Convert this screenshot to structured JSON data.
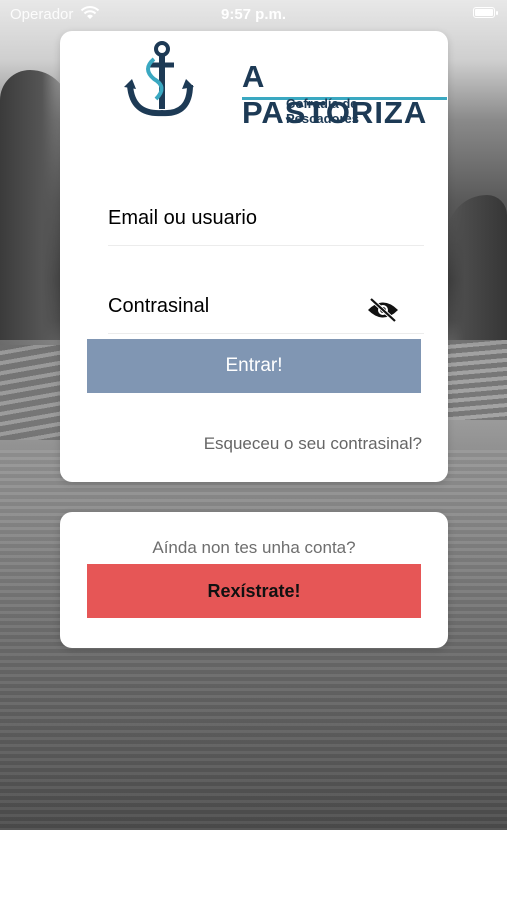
{
  "status_bar": {
    "carrier": "Operador",
    "time": "9:57 p.m.",
    "wifi_icon": "wifi-icon",
    "battery_icon": "battery-icon"
  },
  "logo": {
    "title": "A PASTORIZA",
    "subtitle": "Cofradía de Pescadores",
    "icon": "anchor-icon",
    "colors": {
      "navy": "#1d3a55",
      "teal": "#3aa8c1"
    }
  },
  "login": {
    "email_placeholder": "Email ou usuario",
    "password_placeholder": "Contrasinal",
    "toggle_visibility_icon": "eye-slash-icon",
    "submit_label": "Entrar!",
    "submit_color": "#8096b3",
    "forgot_password": "Esqueceu o seu contrasinal?"
  },
  "register": {
    "prompt": "Aínda non tes unha conta?",
    "button_label": "Rexístrate!",
    "button_color": "#e65656"
  }
}
